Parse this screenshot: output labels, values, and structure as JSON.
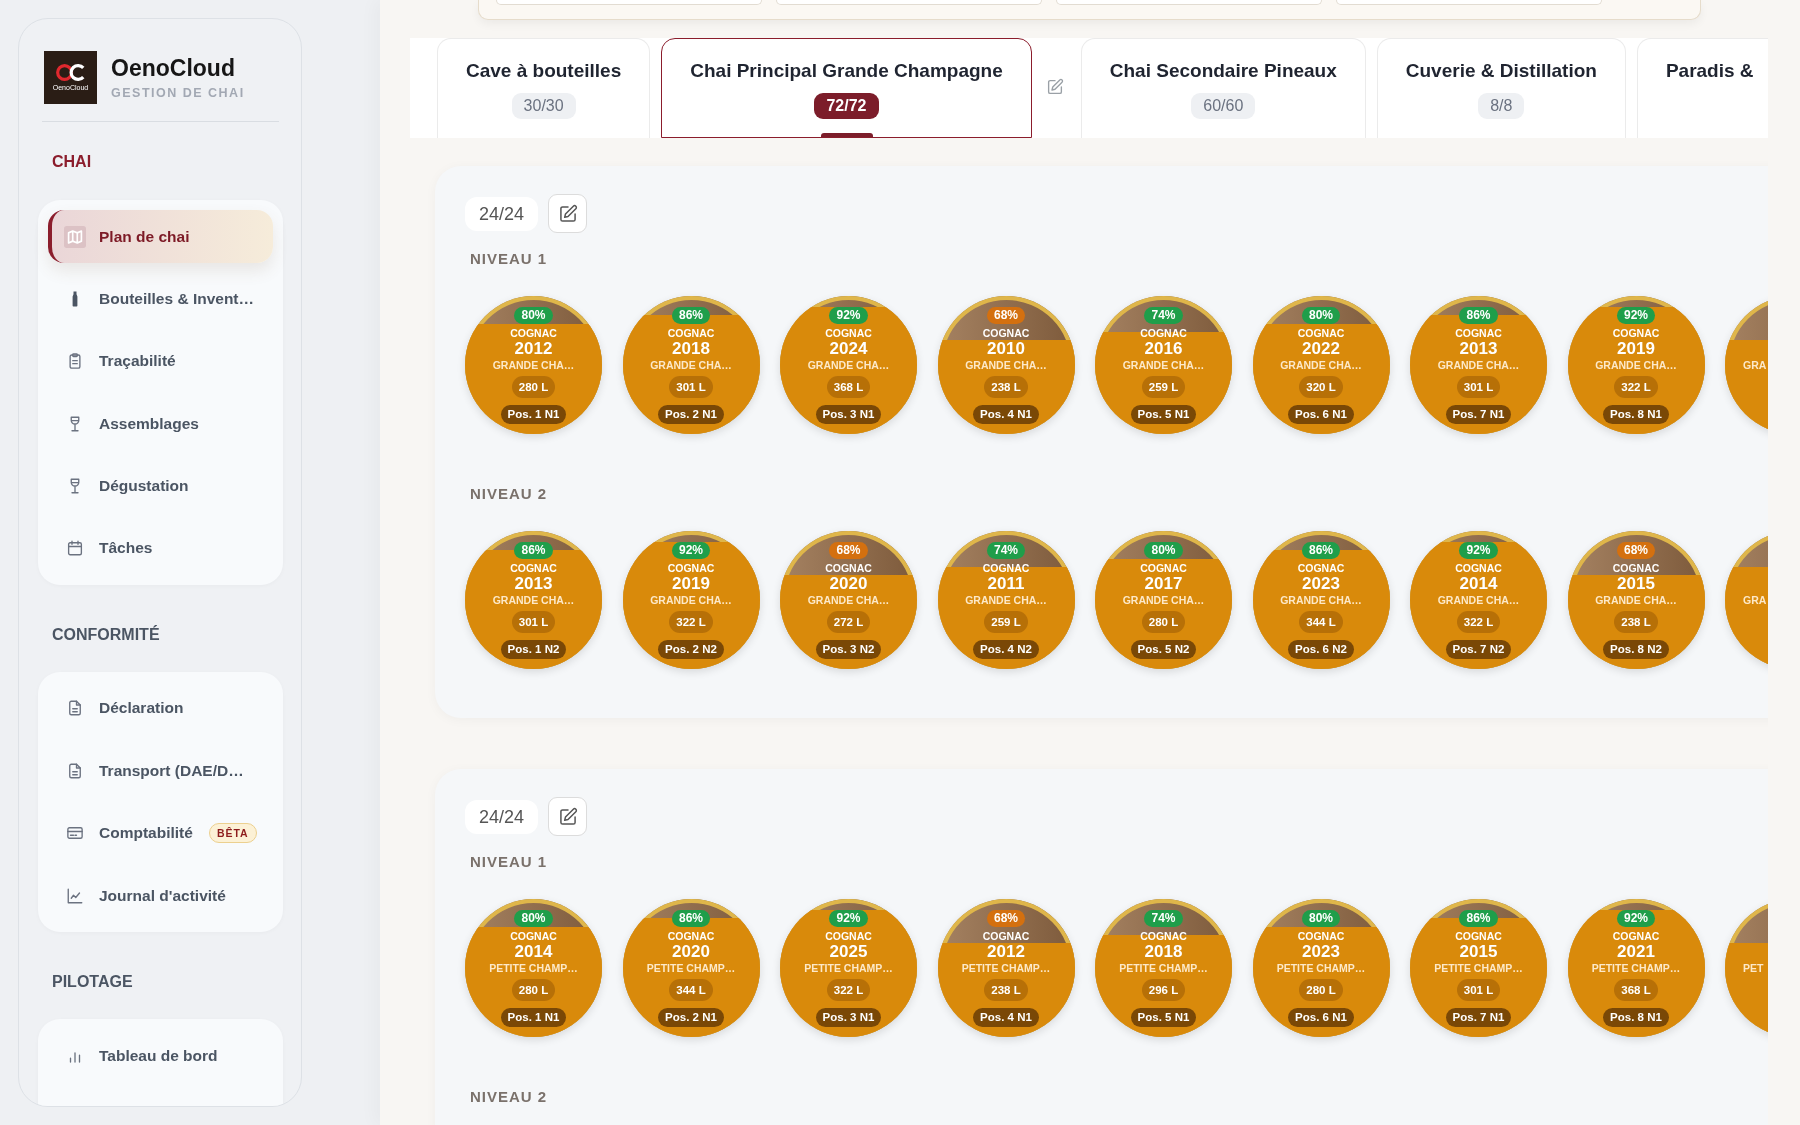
{
  "sidebar": {
    "brand": {
      "name": "OenoCloud",
      "tagline": "GESTION DE CHAI",
      "logo_caption": "OenoCloud"
    },
    "sections": [
      {
        "title": "CHAI",
        "active": true,
        "items": [
          {
            "label": "Plan de chai",
            "selected": true
          },
          {
            "label": "Bouteilles & Invent…",
            "selected": false
          },
          {
            "label": "Traçabilité",
            "selected": false
          },
          {
            "label": "Assemblages",
            "selected": false
          },
          {
            "label": "Dégustation",
            "selected": false
          },
          {
            "label": "Tâches",
            "selected": false
          }
        ]
      },
      {
        "title": "CONFORMITÉ",
        "active": false,
        "items": [
          {
            "label": "Déclaration",
            "selected": false
          },
          {
            "label": "Transport (DAE/D…",
            "selected": false
          },
          {
            "label": "Comptabilité",
            "selected": false,
            "badge": "BÊTA"
          },
          {
            "label": "Journal d'activité",
            "selected": false
          }
        ]
      },
      {
        "title": "PILOTAGE",
        "active": false,
        "items": [
          {
            "label": "Tableau de bord",
            "selected": false
          }
        ]
      }
    ]
  },
  "tabs": [
    {
      "label": "Cave à bouteilles",
      "count": "30/30",
      "selected": false
    },
    {
      "label": "Chai Principal Grande Champagne",
      "count": "72/72",
      "selected": true
    },
    {
      "label": "Chai Secondaire Pineaux",
      "count": "60/60",
      "selected": false
    },
    {
      "label": "Cuverie & Distillation",
      "count": "8/8",
      "selected": false
    },
    {
      "label": "Paradis &",
      "selected": false
    }
  ],
  "racks": [
    {
      "count": "24/24",
      "levels": [
        {
          "label": "NIVEAU 1",
          "barrels": [
            {
              "kind": "full",
              "fill": "80%",
              "color": "#1f9e4a",
              "type": "COGNAC",
              "year": "2012",
              "cru": "GRANDE CHA…",
              "volume": "280 L",
              "position": "Pos. 1 N1",
              "level": 0.8
            },
            {
              "kind": "full",
              "fill": "86%",
              "color": "#1f9e4a",
              "type": "COGNAC",
              "year": "2018",
              "cru": "GRANDE CHA…",
              "volume": "301 L",
              "position": "Pos. 2 N1",
              "level": 0.86
            },
            {
              "kind": "full",
              "fill": "92%",
              "color": "#1f9e4a",
              "type": "COGNAC",
              "year": "2024",
              "cru": "GRANDE CHA…",
              "volume": "368 L",
              "position": "Pos. 3 N1",
              "level": 0.92
            },
            {
              "kind": "full",
              "fill": "68%",
              "color": "#d4700f",
              "type": "COGNAC",
              "year": "2010",
              "cru": "GRANDE CHA…",
              "volume": "238 L",
              "position": "Pos. 4 N1",
              "level": 0.68
            },
            {
              "kind": "full",
              "fill": "74%",
              "color": "#1f9e4a",
              "type": "COGNAC",
              "year": "2016",
              "cru": "GRANDE CHA…",
              "volume": "259 L",
              "position": "Pos. 5 N1",
              "level": 0.74
            },
            {
              "kind": "full",
              "fill": "80%",
              "color": "#1f9e4a",
              "type": "COGNAC",
              "year": "2022",
              "cru": "GRANDE CHA…",
              "volume": "320 L",
              "position": "Pos. 6 N1",
              "level": 0.8
            },
            {
              "kind": "full",
              "fill": "86%",
              "color": "#1f9e4a",
              "type": "COGNAC",
              "year": "2013",
              "cru": "GRANDE CHA…",
              "volume": "301 L",
              "position": "Pos. 7 N1",
              "level": 0.86
            },
            {
              "kind": "full",
              "fill": "92%",
              "color": "#1f9e4a",
              "type": "COGNAC",
              "year": "2019",
              "cru": "GRANDE CHA…",
              "volume": "322 L",
              "position": "Pos. 8 N1",
              "level": 0.92
            },
            {
              "kind": "clipped",
              "cru": "GRA",
              "level": 0.68
            }
          ]
        },
        {
          "label": "NIVEAU 2",
          "barrels": [
            {
              "kind": "full",
              "fill": "86%",
              "color": "#1f9e4a",
              "type": "COGNAC",
              "year": "2013",
              "cru": "GRANDE CHA…",
              "volume": "301 L",
              "position": "Pos. 1 N2",
              "level": 0.86
            },
            {
              "kind": "full",
              "fill": "92%",
              "color": "#1f9e4a",
              "type": "COGNAC",
              "year": "2019",
              "cru": "GRANDE CHA…",
              "volume": "322 L",
              "position": "Pos. 2 N2",
              "level": 0.92
            },
            {
              "kind": "full",
              "fill": "68%",
              "color": "#d4700f",
              "type": "COGNAC",
              "year": "2020",
              "cru": "GRANDE CHA…",
              "volume": "272 L",
              "position": "Pos. 3 N2",
              "level": 0.68
            },
            {
              "kind": "full",
              "fill": "74%",
              "color": "#1f9e4a",
              "type": "COGNAC",
              "year": "2011",
              "cru": "GRANDE CHA…",
              "volume": "259 L",
              "position": "Pos. 4 N2",
              "level": 0.74
            },
            {
              "kind": "full",
              "fill": "80%",
              "color": "#1f9e4a",
              "type": "COGNAC",
              "year": "2017",
              "cru": "GRANDE CHA…",
              "volume": "280 L",
              "position": "Pos. 5 N2",
              "level": 0.8
            },
            {
              "kind": "full",
              "fill": "86%",
              "color": "#1f9e4a",
              "type": "COGNAC",
              "year": "2023",
              "cru": "GRANDE CHA…",
              "volume": "344 L",
              "position": "Pos. 6 N2",
              "level": 0.86
            },
            {
              "kind": "full",
              "fill": "92%",
              "color": "#1f9e4a",
              "type": "COGNAC",
              "year": "2014",
              "cru": "GRANDE CHA…",
              "volume": "322 L",
              "position": "Pos. 7 N2",
              "level": 0.92
            },
            {
              "kind": "full",
              "fill": "68%",
              "color": "#d4700f",
              "type": "COGNAC",
              "year": "2015",
              "cru": "GRANDE CHA…",
              "volume": "238 L",
              "position": "Pos. 8 N2",
              "level": 0.68
            },
            {
              "kind": "clipped",
              "cru": "GRA",
              "level": 0.74
            }
          ]
        }
      ]
    },
    {
      "count": "24/24",
      "levels": [
        {
          "label": "NIVEAU 1",
          "barrels": [
            {
              "kind": "full",
              "fill": "80%",
              "color": "#1f9e4a",
              "type": "COGNAC",
              "year": "2014",
              "cru": "PETITE CHAMP…",
              "volume": "280 L",
              "position": "Pos. 1 N1",
              "level": 0.8
            },
            {
              "kind": "full",
              "fill": "86%",
              "color": "#1f9e4a",
              "type": "COGNAC",
              "year": "2020",
              "cru": "PETITE CHAMP…",
              "volume": "344 L",
              "position": "Pos. 2 N1",
              "level": 0.86
            },
            {
              "kind": "full",
              "fill": "92%",
              "color": "#1f9e4a",
              "type": "COGNAC",
              "year": "2025",
              "cru": "PETITE CHAMP…",
              "volume": "322 L",
              "position": "Pos. 3 N1",
              "level": 0.92
            },
            {
              "kind": "full",
              "fill": "68%",
              "color": "#d4700f",
              "type": "COGNAC",
              "year": "2012",
              "cru": "PETITE CHAMP…",
              "volume": "238 L",
              "position": "Pos. 4 N1",
              "level": 0.68
            },
            {
              "kind": "full",
              "fill": "74%",
              "color": "#1f9e4a",
              "type": "COGNAC",
              "year": "2018",
              "cru": "PETITE CHAMP…",
              "volume": "296 L",
              "position": "Pos. 5 N1",
              "level": 0.74
            },
            {
              "kind": "full",
              "fill": "80%",
              "color": "#1f9e4a",
              "type": "COGNAC",
              "year": "2023",
              "cru": "PETITE CHAMP…",
              "volume": "280 L",
              "position": "Pos. 6 N1",
              "level": 0.8
            },
            {
              "kind": "full",
              "fill": "86%",
              "color": "#1f9e4a",
              "type": "COGNAC",
              "year": "2015",
              "cru": "PETITE CHAMP…",
              "volume": "301 L",
              "position": "Pos. 7 N1",
              "level": 0.86
            },
            {
              "kind": "full",
              "fill": "92%",
              "color": "#1f9e4a",
              "type": "COGNAC",
              "year": "2021",
              "cru": "PETITE CHAMP…",
              "volume": "368 L",
              "position": "Pos. 8 N1",
              "level": 0.92
            },
            {
              "kind": "clipped",
              "cru": "PET",
              "level": 0.68
            }
          ]
        },
        {
          "label": "NIVEAU 2"
        }
      ]
    }
  ]
}
